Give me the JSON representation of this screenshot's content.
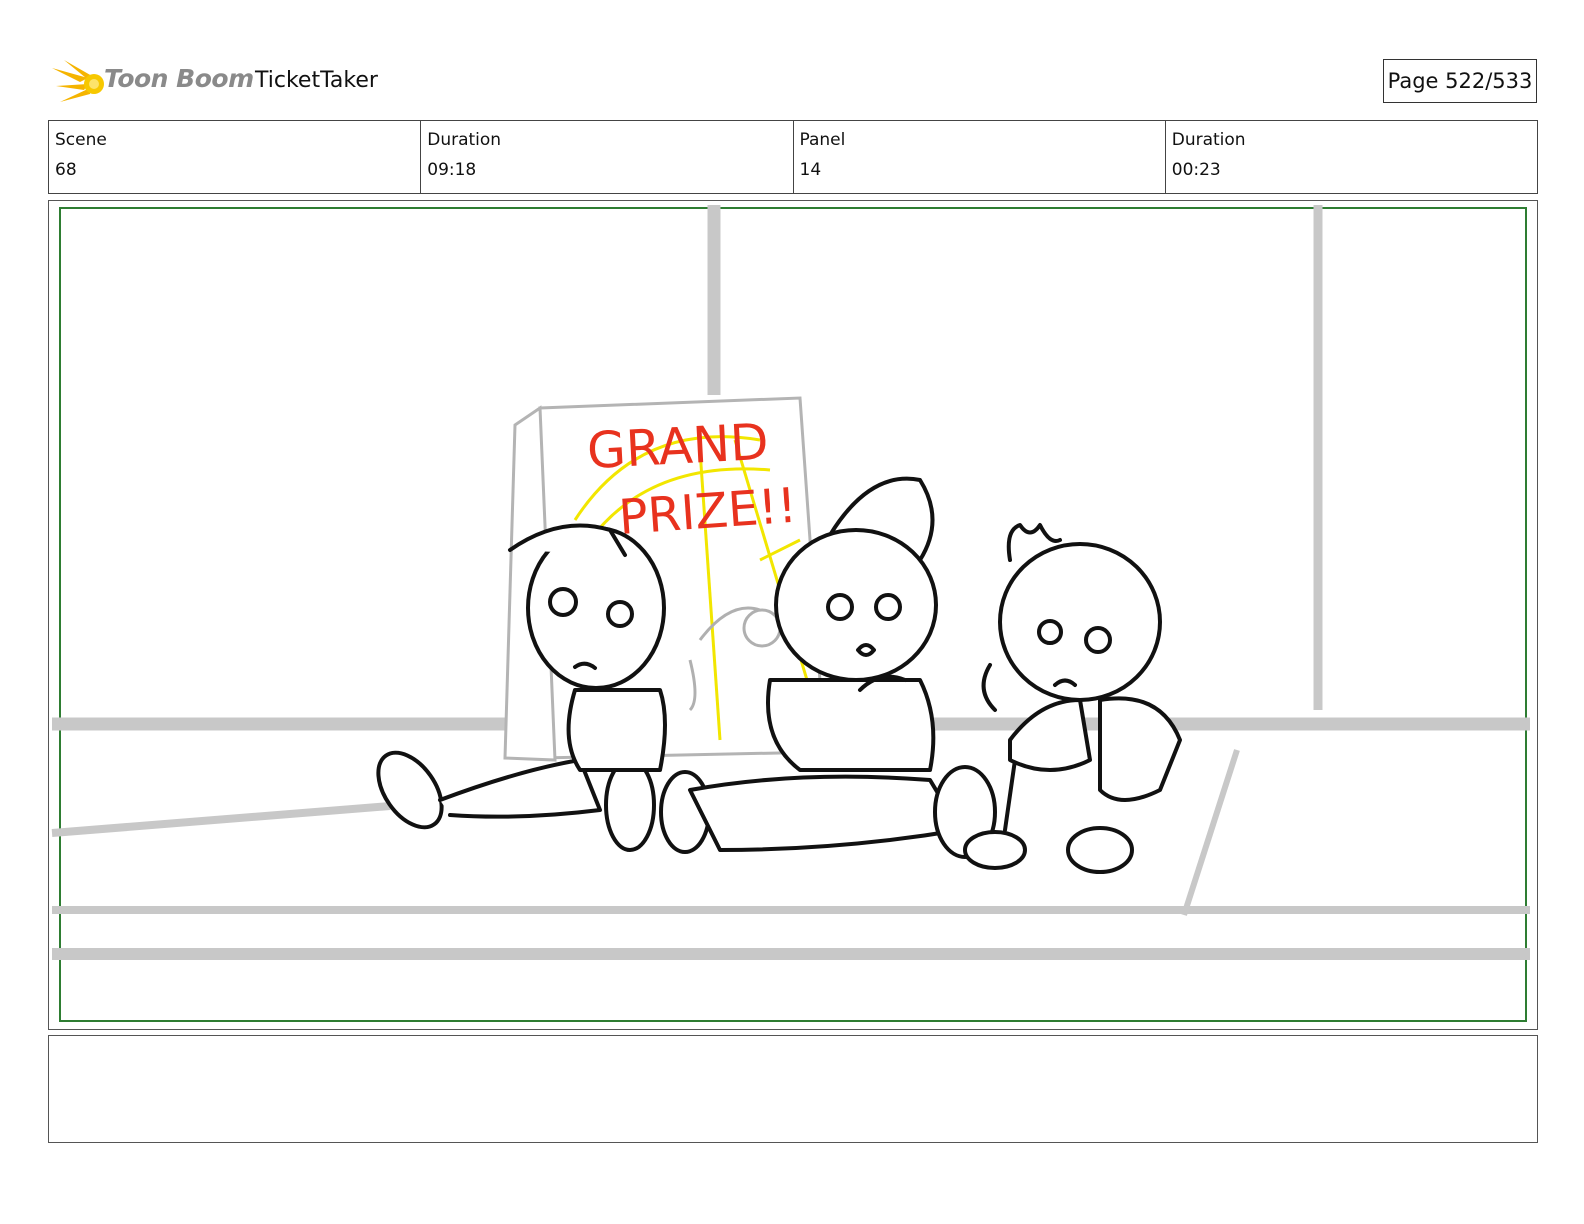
{
  "header": {
    "logo_text": "Toon Boom",
    "project_title": "TicketTaker",
    "page_label": "Page 522/533"
  },
  "info": {
    "scene_label": "Scene",
    "scene_value": "68",
    "scene_duration_label": "Duration",
    "scene_duration_value": "09:18",
    "panel_label": "Panel",
    "panel_value": "14",
    "panel_duration_label": "Duration",
    "panel_duration_value": "00:23"
  },
  "panel": {
    "sign_line1": "GRAND",
    "sign_line2": "PRIZE!!",
    "safe_frame_color": "#2e7d32",
    "sign_text_color": "#e8321e",
    "sign_burst_color": "#f2e600"
  },
  "notes": {}
}
